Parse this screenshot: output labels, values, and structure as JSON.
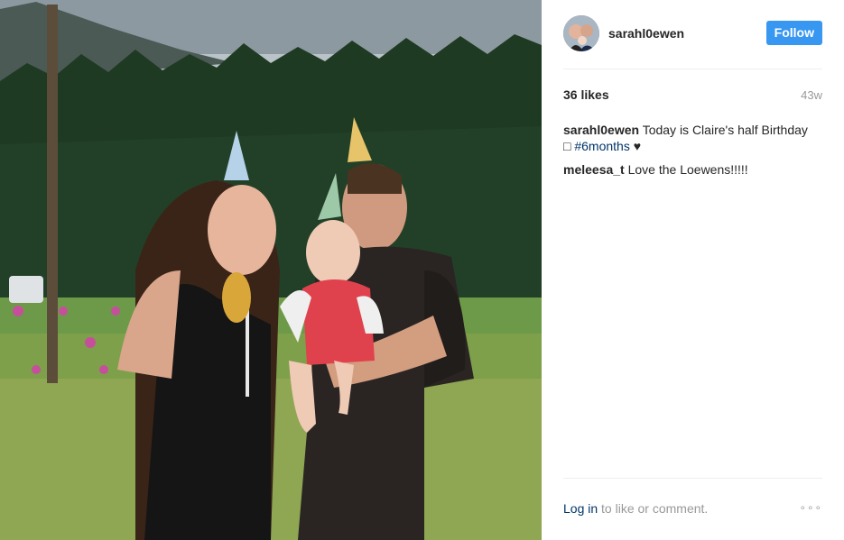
{
  "post": {
    "username": "sarahl0ewen",
    "follow_label": "Follow",
    "likes": "36 likes",
    "age": "43w"
  },
  "comments": [
    {
      "user": "sarahl0ewen",
      "text": "Today is Claire's half Birthday",
      "text2": "□",
      "hashtag": "#6months",
      "heart": "♥"
    },
    {
      "user": "meleesa_t",
      "text": "Love the Loewens!!!!!"
    }
  ],
  "footer": {
    "login_link": "Log in",
    "rest": "to like or comment.",
    "more_icon": "∘∘∘"
  },
  "photo": {
    "icon": "family-birthday-photo"
  }
}
